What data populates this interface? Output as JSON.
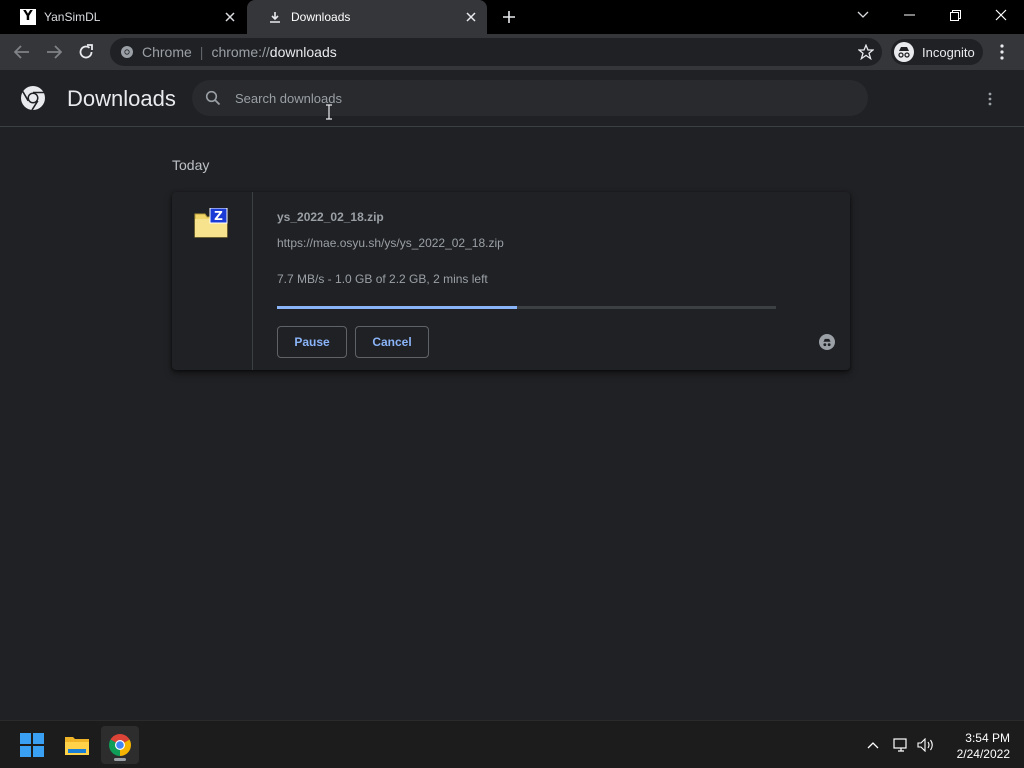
{
  "tabs": [
    {
      "title": "YanSimDL",
      "favicon": "Y"
    },
    {
      "title": "Downloads",
      "favicon": "download-icon"
    }
  ],
  "omnibox": {
    "scheme_label": "Chrome",
    "url_prefix": "chrome://",
    "url_main": "downloads"
  },
  "profile": {
    "label": "Incognito"
  },
  "downloads_page": {
    "title": "Downloads",
    "search_placeholder": "Search downloads",
    "date_group": "Today",
    "item": {
      "file_name": "ys_2022_02_18.zip",
      "url": "https://mae.osyu.sh/ys/ys_2022_02_18.zip",
      "status": "7.7 MB/s - 1.0 GB of 2.2 GB, 2 mins left",
      "progress_fraction": 0.48,
      "pause_label": "Pause",
      "cancel_label": "Cancel",
      "file_icon_letter": "Z"
    }
  },
  "taskbar": {
    "time": "3:54 PM",
    "date": "2/24/2022"
  },
  "colors": {
    "accent": "#8ab4f8",
    "background": "#202124",
    "tabstrip": "#000000",
    "toolbar": "#35363a"
  }
}
